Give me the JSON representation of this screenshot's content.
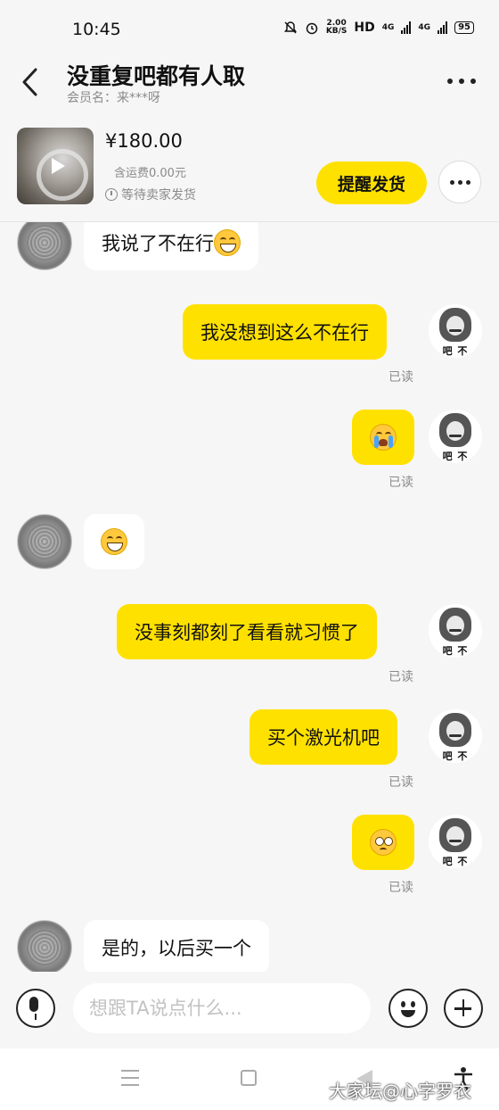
{
  "status_bar": {
    "time": "10:45",
    "speed_value": "2.00",
    "speed_unit": "KB/S",
    "hd": "HD",
    "net1": "4G",
    "net2": "4G",
    "battery": "95",
    "icons": [
      "mute-bell-icon",
      "alarm-icon"
    ]
  },
  "header": {
    "title": "没重复吧都有人取",
    "member": "会员名：来***呀"
  },
  "product": {
    "price": "¥180.00",
    "shipping": "含运费0.00元",
    "status": "等待卖家发货",
    "remind_label": "提醒发货"
  },
  "messages": [
    {
      "side": "left",
      "text": "我说了不在行",
      "emoji": "grin"
    },
    {
      "side": "right",
      "text": "我没想到这么不在行",
      "read": "已读"
    },
    {
      "side": "right",
      "text": "",
      "emoji": "cry",
      "read": "已读"
    },
    {
      "side": "left",
      "text": "",
      "emoji": "grin"
    },
    {
      "side": "right",
      "text": "没事刻都刻了看看就习惯了",
      "read": "已读"
    },
    {
      "side": "right",
      "text": "买个激光机吧",
      "read": "已读"
    },
    {
      "side": "right",
      "text": "",
      "emoji": "pleading",
      "read": "已读"
    },
    {
      "side": "left",
      "text": "是的，以后买一个"
    }
  ],
  "avatar_caption": "吧 不",
  "input": {
    "placeholder": "想跟TA说点什么..."
  },
  "watermark": "大家坛@心字罗衣"
}
